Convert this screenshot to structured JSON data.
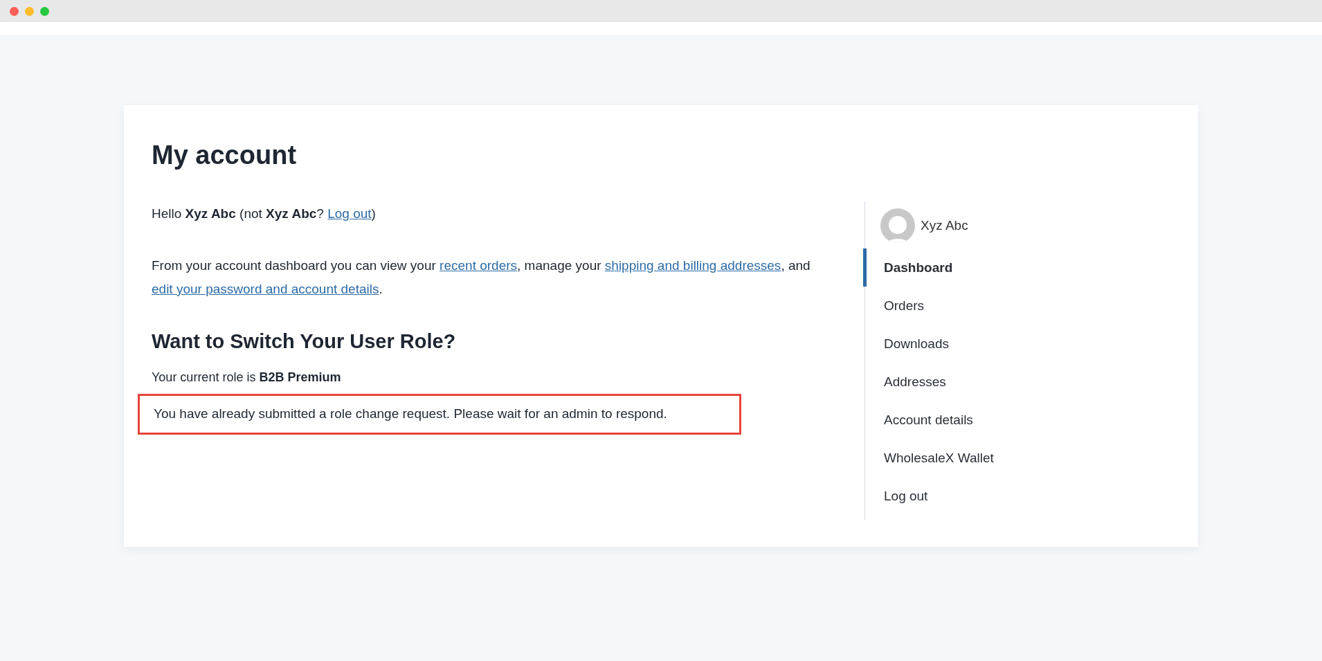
{
  "window": {
    "controls": [
      {
        "color": "#fe5f57"
      },
      {
        "color": "#febc2e"
      },
      {
        "color": "#28c840"
      }
    ]
  },
  "page": {
    "title": "My account",
    "greeting": [
      {
        "kind": "text",
        "text": "Hello **Xyz Abc** (not **Xyz Abc**? "
      },
      {
        "kind": "link",
        "text": "Log out"
      },
      {
        "kind": "text",
        "text": ")"
      }
    ],
    "intro": [
      {
        "kind": "text",
        "text": "From your account dashboard you can view your "
      },
      {
        "kind": "link",
        "text": "recent orders"
      },
      {
        "kind": "text",
        "text": ", manage your "
      },
      {
        "kind": "link",
        "text": "shipping and billing addresses"
      },
      {
        "kind": "text",
        "text": ", and "
      },
      {
        "kind": "link",
        "text": "edit your password and account details"
      },
      {
        "kind": "text",
        "text": "."
      }
    ],
    "role_section": {
      "heading": "Want to Switch Your User Role?",
      "current_role": "Your current role is **B2B Premium**",
      "notice": "You have already submitted a role change request. Please wait for an admin to respond.",
      "notice_highlighted": true
    }
  },
  "sidebar": {
    "user_name": "Xyz Abc",
    "items": [
      {
        "label": "Dashboard",
        "selected": true
      },
      {
        "label": "Orders",
        "selected": false
      },
      {
        "label": "Downloads",
        "selected": false
      },
      {
        "label": "Addresses",
        "selected": false
      },
      {
        "label": "Account details",
        "selected": false
      },
      {
        "label": "WholesaleX Wallet",
        "selected": false
      },
      {
        "label": "Log out",
        "selected": false
      }
    ]
  }
}
